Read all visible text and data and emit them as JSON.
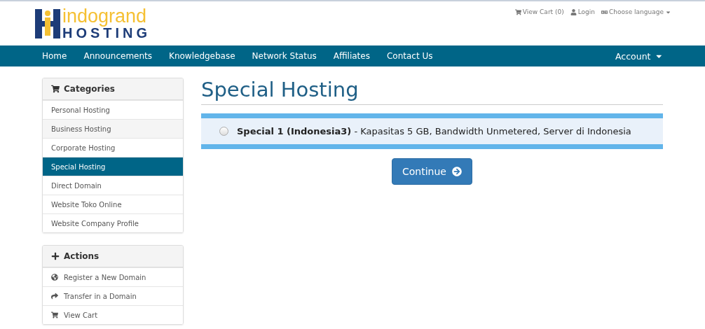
{
  "logo": {
    "top": "indogrand",
    "bottom": "HOSTING"
  },
  "top_links": [
    {
      "kind": "cart",
      "label": "View Cart (0)"
    },
    {
      "kind": "user",
      "label": "Login"
    },
    {
      "kind": "language",
      "label": "Choose language"
    }
  ],
  "nav": {
    "items": [
      "Home",
      "Announcements",
      "Knowledgebase",
      "Network Status",
      "Affiliates",
      "Contact Us"
    ],
    "account": "Account"
  },
  "categories": {
    "title": "Categories",
    "items": [
      {
        "label": "Personal Hosting",
        "selected": false
      },
      {
        "label": "Business Hosting",
        "selected": false
      },
      {
        "label": "Corporate Hosting",
        "selected": false
      },
      {
        "label": "Special Hosting",
        "selected": true
      },
      {
        "label": "Direct Domain",
        "selected": false
      },
      {
        "label": "Website Toko Online",
        "selected": false
      },
      {
        "label": "Website Company Profile",
        "selected": false
      }
    ]
  },
  "actions": {
    "title": "Actions",
    "items": [
      {
        "kind": "globe",
        "label": "Register a New Domain"
      },
      {
        "kind": "share",
        "label": "Transfer in a Domain"
      },
      {
        "kind": "cart",
        "label": "View Cart"
      }
    ]
  },
  "page_title": "Special Hosting",
  "products": [
    {
      "name": "Special 1 (Indonesia3)",
      "description": " - Kapasitas 5 GB, Bandwidth Unmetered, Server di Indonesia",
      "selected": false
    }
  ],
  "continue_button": "Continue"
}
